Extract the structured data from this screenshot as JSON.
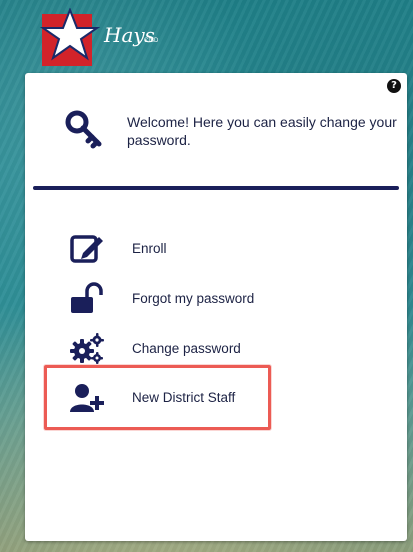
{
  "logo": {
    "script_text": "Hays",
    "small_text": "CISD"
  },
  "panel": {
    "help_label": "?",
    "welcome_text": "Welcome! Here you can easily change your password.",
    "menu": [
      {
        "id": "enroll",
        "label": "Enroll",
        "icon": "edit-icon"
      },
      {
        "id": "forgot",
        "label": "Forgot my password",
        "icon": "unlock-icon"
      },
      {
        "id": "change",
        "label": "Change password",
        "icon": "gears-icon"
      },
      {
        "id": "new-staff",
        "label": "New District Staff",
        "icon": "add-user-icon"
      }
    ]
  },
  "colors": {
    "navy": "#1a1f5a",
    "highlight": "#ec5b54",
    "logo_red": "#d2232a"
  }
}
